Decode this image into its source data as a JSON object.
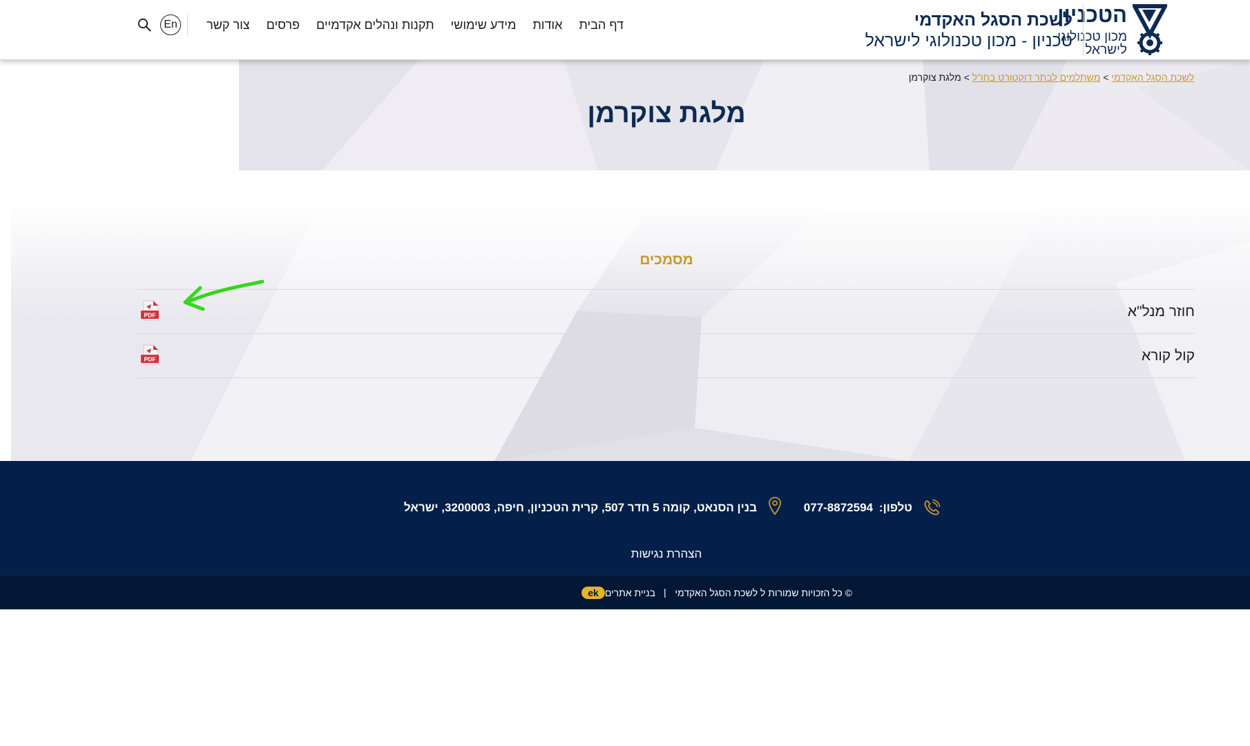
{
  "header": {
    "logo_name": "הטכניון",
    "logo_subtitle": "מכון טכנולוגי לישראל",
    "org_title": "לשכת הסגל האקדמי",
    "org_subtitle": "טכניון - מכון טכנולוגי לישראל",
    "nav": [
      {
        "label": "דף הבית"
      },
      {
        "label": "אודות"
      },
      {
        "label": "מידע שימושי"
      },
      {
        "label": "תקנות ונהלים אקדמיים"
      },
      {
        "label": "פרסים"
      },
      {
        "label": "צור קשר"
      }
    ],
    "lang_label": "En",
    "search_icon": "search-icon"
  },
  "breadcrumb": {
    "home": "לשכת הסגל האקדמי",
    "separator": ">",
    "section": "משתלמים לבתר דוקטורט בחו\"ל",
    "current": "מלגת צוקרמן"
  },
  "page": {
    "title": "מלגת צוקרמן"
  },
  "documents": {
    "heading": "מסמכים",
    "items": [
      {
        "title": "חוזר מנל\"א",
        "icon": "pdf-icon",
        "icon_text": "PDF"
      },
      {
        "title": "קול קורא",
        "icon": "pdf-icon",
        "icon_text": "PDF"
      }
    ]
  },
  "footer": {
    "phone_label": "טלפון:",
    "phone": "077-8872594",
    "address": "בנין הסנאט, קומה 5 חדר 507, קרית הטכניון, חיפה, 3200003, ישראל",
    "accessibility": "הצהרת נגישות",
    "copyright": "© כל הזכויות שמורות ל לשכת הסגל האקדמי",
    "separator": "|",
    "credit": "בניית אתרים",
    "credit_logo_text": "ek"
  },
  "colors": {
    "navy": "#0c2a54",
    "gold": "#c59a2e",
    "footer_bg": "#04204a",
    "footer_bottom_bg": "#011735",
    "pdf_red": "#d4323f",
    "annotation_green": "#35d61e"
  }
}
